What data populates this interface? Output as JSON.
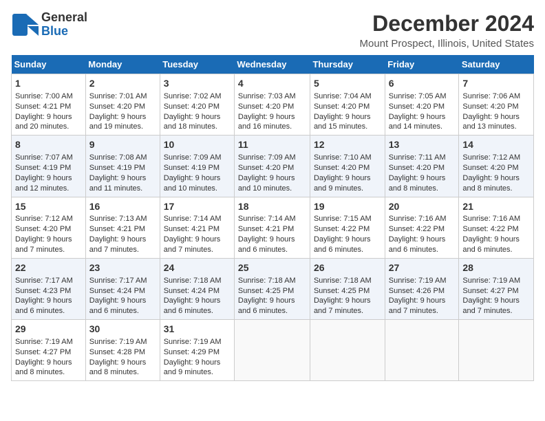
{
  "header": {
    "logo_line1": "General",
    "logo_line2": "Blue",
    "month": "December 2024",
    "location": "Mount Prospect, Illinois, United States"
  },
  "days_of_week": [
    "Sunday",
    "Monday",
    "Tuesday",
    "Wednesday",
    "Thursday",
    "Friday",
    "Saturday"
  ],
  "weeks": [
    [
      {
        "day": "1",
        "sunrise": "7:00 AM",
        "sunset": "4:21 PM",
        "daylight": "9 hours and 20 minutes."
      },
      {
        "day": "2",
        "sunrise": "7:01 AM",
        "sunset": "4:20 PM",
        "daylight": "9 hours and 19 minutes."
      },
      {
        "day": "3",
        "sunrise": "7:02 AM",
        "sunset": "4:20 PM",
        "daylight": "9 hours and 18 minutes."
      },
      {
        "day": "4",
        "sunrise": "7:03 AM",
        "sunset": "4:20 PM",
        "daylight": "9 hours and 16 minutes."
      },
      {
        "day": "5",
        "sunrise": "7:04 AM",
        "sunset": "4:20 PM",
        "daylight": "9 hours and 15 minutes."
      },
      {
        "day": "6",
        "sunrise": "7:05 AM",
        "sunset": "4:20 PM",
        "daylight": "9 hours and 14 minutes."
      },
      {
        "day": "7",
        "sunrise": "7:06 AM",
        "sunset": "4:20 PM",
        "daylight": "9 hours and 13 minutes."
      }
    ],
    [
      {
        "day": "8",
        "sunrise": "7:07 AM",
        "sunset": "4:19 PM",
        "daylight": "9 hours and 12 minutes."
      },
      {
        "day": "9",
        "sunrise": "7:08 AM",
        "sunset": "4:19 PM",
        "daylight": "9 hours and 11 minutes."
      },
      {
        "day": "10",
        "sunrise": "7:09 AM",
        "sunset": "4:19 PM",
        "daylight": "9 hours and 10 minutes."
      },
      {
        "day": "11",
        "sunrise": "7:09 AM",
        "sunset": "4:20 PM",
        "daylight": "9 hours and 10 minutes."
      },
      {
        "day": "12",
        "sunrise": "7:10 AM",
        "sunset": "4:20 PM",
        "daylight": "9 hours and 9 minutes."
      },
      {
        "day": "13",
        "sunrise": "7:11 AM",
        "sunset": "4:20 PM",
        "daylight": "9 hours and 8 minutes."
      },
      {
        "day": "14",
        "sunrise": "7:12 AM",
        "sunset": "4:20 PM",
        "daylight": "9 hours and 8 minutes."
      }
    ],
    [
      {
        "day": "15",
        "sunrise": "7:12 AM",
        "sunset": "4:20 PM",
        "daylight": "9 hours and 7 minutes."
      },
      {
        "day": "16",
        "sunrise": "7:13 AM",
        "sunset": "4:21 PM",
        "daylight": "9 hours and 7 minutes."
      },
      {
        "day": "17",
        "sunrise": "7:14 AM",
        "sunset": "4:21 PM",
        "daylight": "9 hours and 7 minutes."
      },
      {
        "day": "18",
        "sunrise": "7:14 AM",
        "sunset": "4:21 PM",
        "daylight": "9 hours and 6 minutes."
      },
      {
        "day": "19",
        "sunrise": "7:15 AM",
        "sunset": "4:22 PM",
        "daylight": "9 hours and 6 minutes."
      },
      {
        "day": "20",
        "sunrise": "7:16 AM",
        "sunset": "4:22 PM",
        "daylight": "9 hours and 6 minutes."
      },
      {
        "day": "21",
        "sunrise": "7:16 AM",
        "sunset": "4:22 PM",
        "daylight": "9 hours and 6 minutes."
      }
    ],
    [
      {
        "day": "22",
        "sunrise": "7:17 AM",
        "sunset": "4:23 PM",
        "daylight": "9 hours and 6 minutes."
      },
      {
        "day": "23",
        "sunrise": "7:17 AM",
        "sunset": "4:24 PM",
        "daylight": "9 hours and 6 minutes."
      },
      {
        "day": "24",
        "sunrise": "7:18 AM",
        "sunset": "4:24 PM",
        "daylight": "9 hours and 6 minutes."
      },
      {
        "day": "25",
        "sunrise": "7:18 AM",
        "sunset": "4:25 PM",
        "daylight": "9 hours and 6 minutes."
      },
      {
        "day": "26",
        "sunrise": "7:18 AM",
        "sunset": "4:25 PM",
        "daylight": "9 hours and 7 minutes."
      },
      {
        "day": "27",
        "sunrise": "7:19 AM",
        "sunset": "4:26 PM",
        "daylight": "9 hours and 7 minutes."
      },
      {
        "day": "28",
        "sunrise": "7:19 AM",
        "sunset": "4:27 PM",
        "daylight": "9 hours and 7 minutes."
      }
    ],
    [
      {
        "day": "29",
        "sunrise": "7:19 AM",
        "sunset": "4:27 PM",
        "daylight": "9 hours and 8 minutes."
      },
      {
        "day": "30",
        "sunrise": "7:19 AM",
        "sunset": "4:28 PM",
        "daylight": "9 hours and 8 minutes."
      },
      {
        "day": "31",
        "sunrise": "7:19 AM",
        "sunset": "4:29 PM",
        "daylight": "9 hours and 9 minutes."
      },
      null,
      null,
      null,
      null
    ]
  ]
}
